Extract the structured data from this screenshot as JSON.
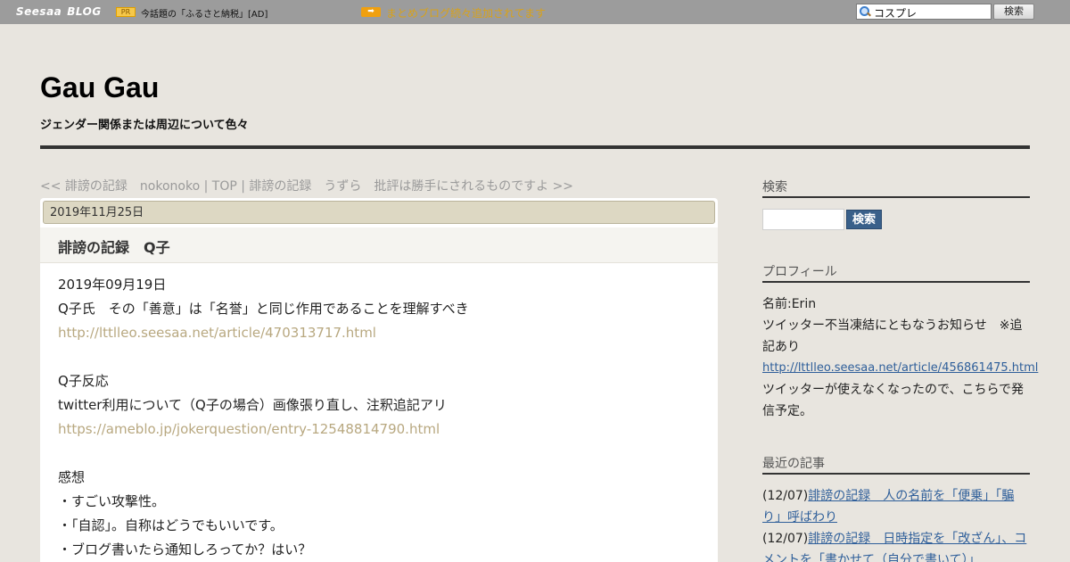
{
  "topbar": {
    "logo": "Seesaa",
    "logo_suffix": "BLOG",
    "pr_label": "PR",
    "pr_text": "今話題の「ふるさと納税」[AD]",
    "arrow_icon": "arrow-right-icon",
    "notice": "まとめブログ続々追加されてます",
    "search_value": "コスプレ",
    "search_button": "検索"
  },
  "header": {
    "title": "Gau Gau",
    "description": "ジェンダー関係または周辺について色々"
  },
  "nav": {
    "prev": "<< 誹謗の記録　nokonoko",
    "separator1": " | ",
    "top": "TOP",
    "separator2": " | ",
    "next": "誹謗の記録　うずら　批評は勝手にされるものですよ >>"
  },
  "article": {
    "date": "2019年11月25日",
    "title": "誹謗の記録　Q子",
    "body": [
      {
        "text": "2019年09月19日",
        "link": false
      },
      {
        "text": "Q子氏　その「善意」は「名誉」と同じ作用であることを理解すべき",
        "link": false
      },
      {
        "text": "http://lttlleo.seesaa.net/article/470313717.html",
        "link": true
      },
      {
        "text": "",
        "link": false
      },
      {
        "text": "Q子反応",
        "link": false
      },
      {
        "text": "twitter利用について（Q子の場合）画像張り直し、注釈追記アリ",
        "link": false
      },
      {
        "text": "https://ameblo.jp/jokerquestion/entry-12548814790.html",
        "link": true
      },
      {
        "text": "",
        "link": false
      },
      {
        "text": "感想",
        "link": false
      },
      {
        "text": "・すごい攻撃性。",
        "link": false
      },
      {
        "text": "・「自認」。自称はどうでもいいです。",
        "link": false
      },
      {
        "text": "・ブログ書いたら通知しろってか？はい？",
        "link": false
      }
    ]
  },
  "sidebar": {
    "search_heading": "検索",
    "search_button": "検索",
    "profile_heading": "プロフィール",
    "profile_name": "名前:Erin",
    "profile_text1": "ツイッター不当凍結にともなうお知らせ　※追記あり",
    "profile_link": "http://lttlleo.seesaa.net/article/456861475.html",
    "profile_text2": "ツイッターが使えなくなったので、こちらで発信予定。",
    "recent_heading": "最近の記事",
    "recent": [
      {
        "date": "(12/07)",
        "title": "誹謗の記録　人の名前を「便乗」「騙り」呼ばわり"
      },
      {
        "date": "(12/07)",
        "title": "誹謗の記録　日時指定を「改ざん」、コメントを「書かせて（自分で書いて）」"
      }
    ]
  }
}
